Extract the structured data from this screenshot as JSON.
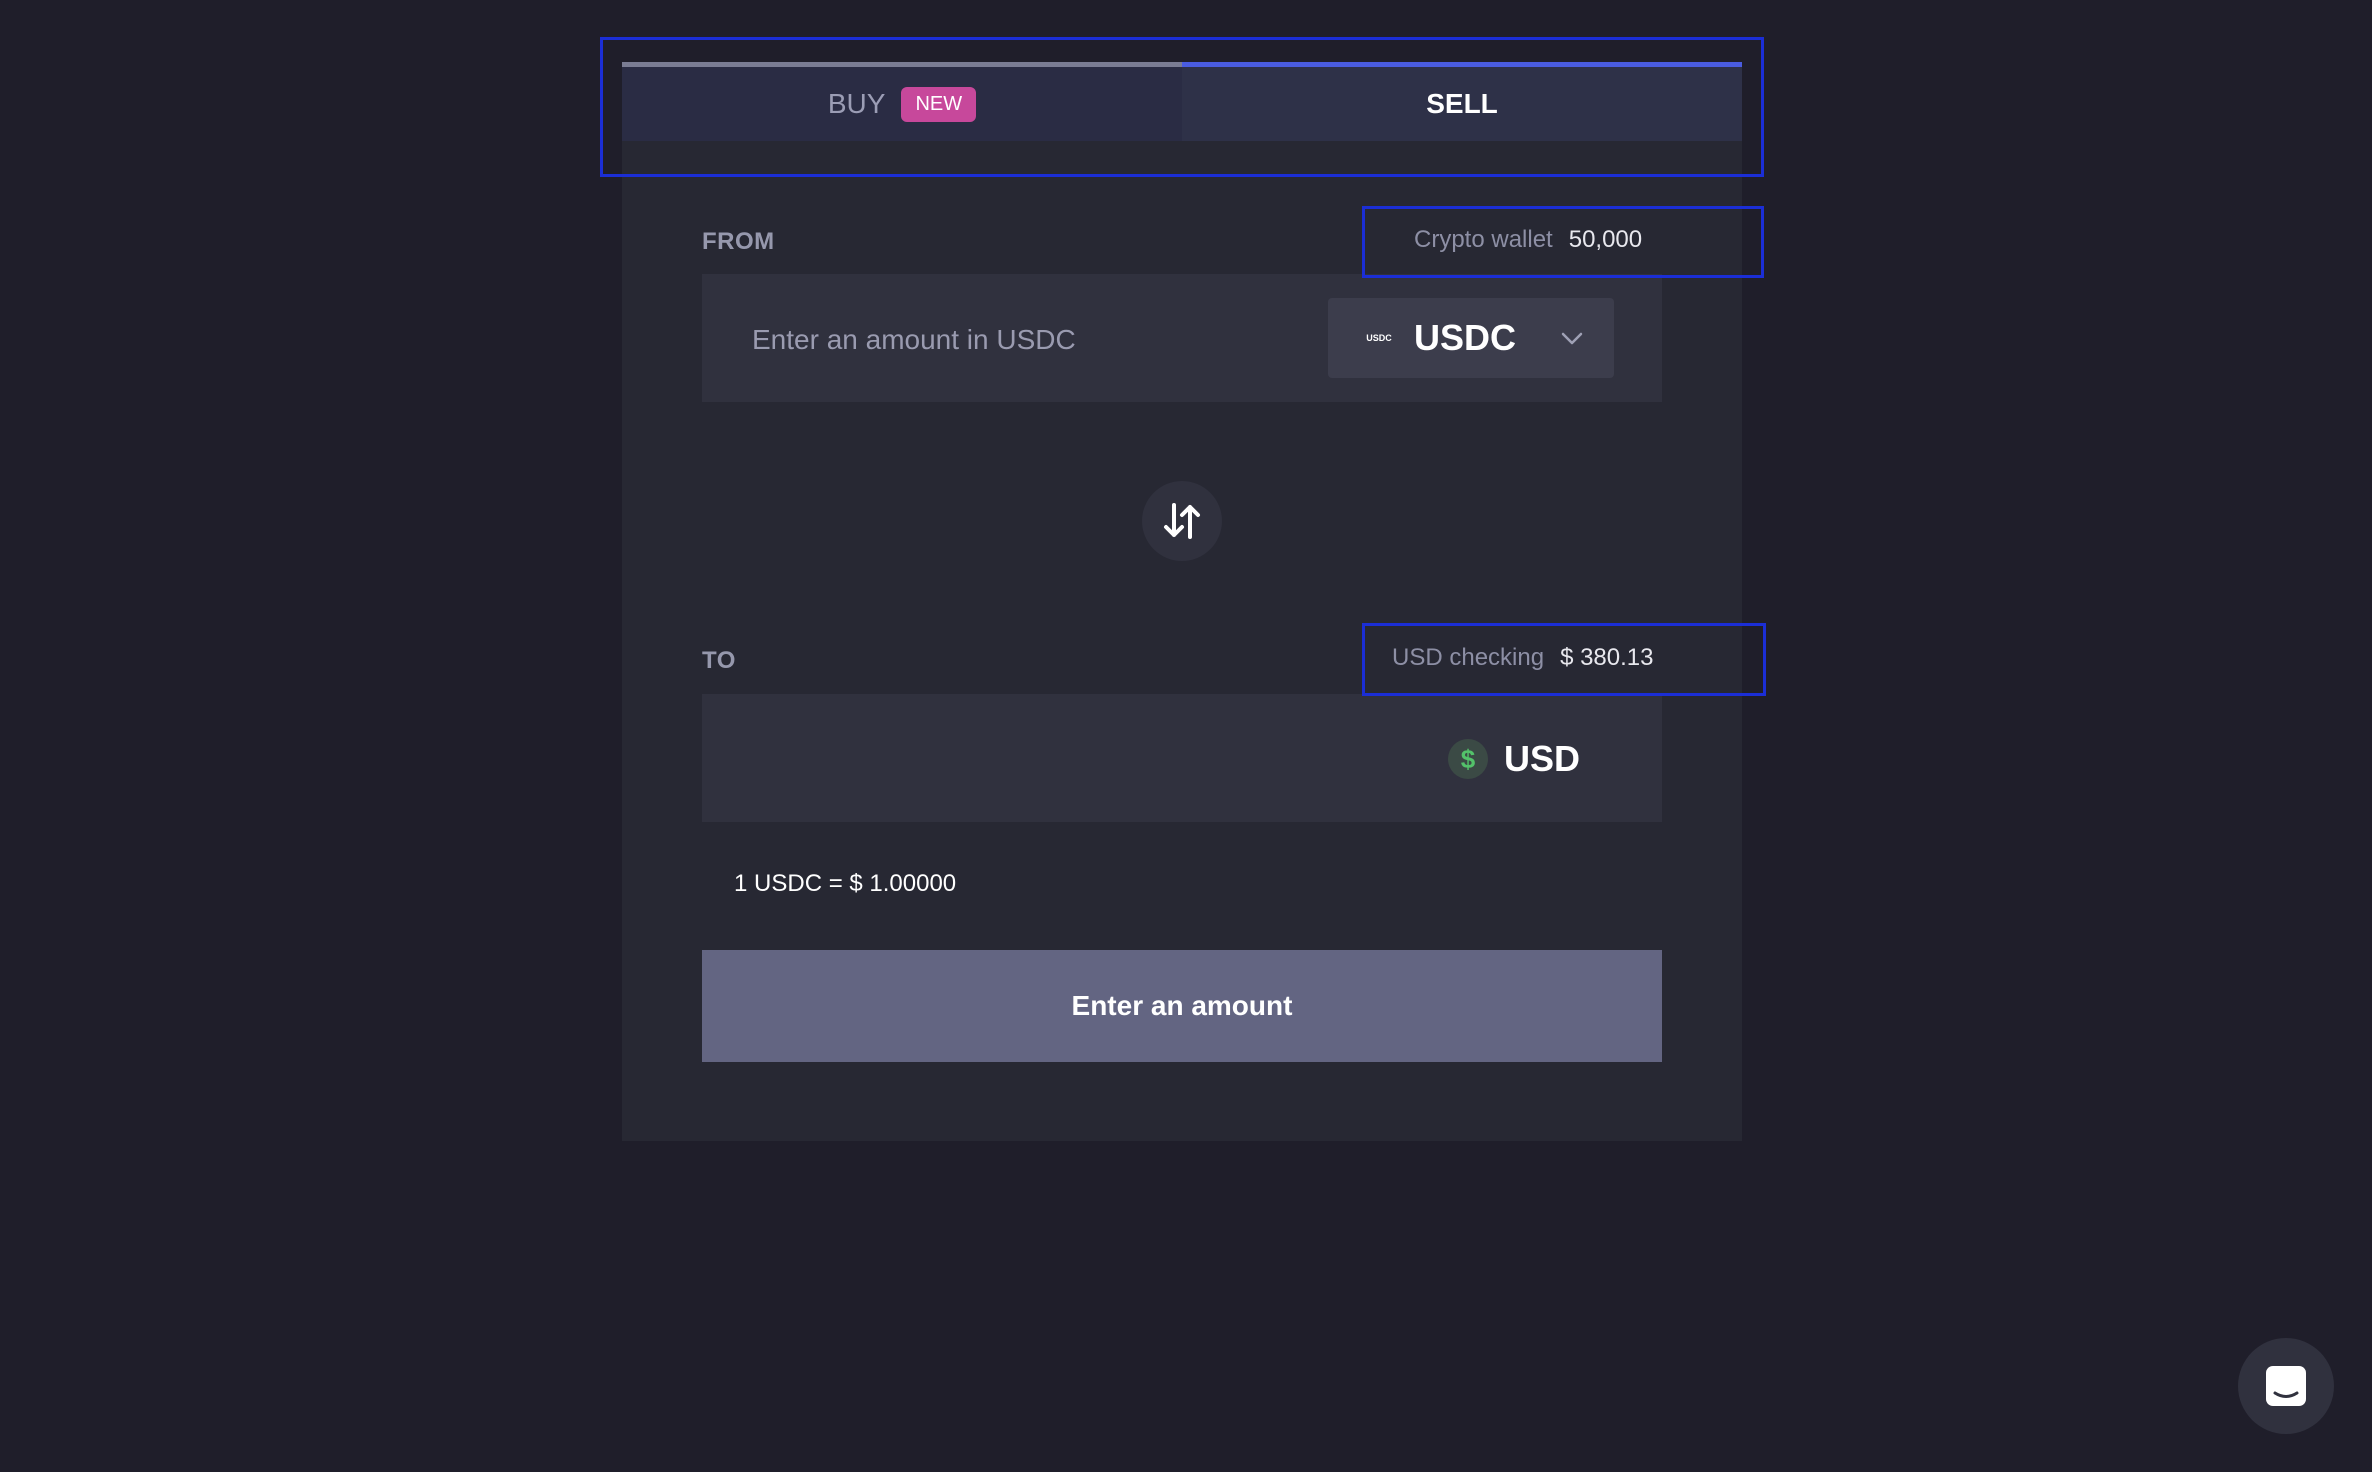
{
  "tabs": {
    "buy_label": "BUY",
    "buy_badge": "NEW",
    "sell_label": "SELL",
    "active": "SELL"
  },
  "from": {
    "label": "FROM",
    "balance_label": "Crypto wallet",
    "balance_value": "50,000",
    "amount_value": "",
    "amount_placeholder": "Enter an amount in USDC",
    "token": "USDC",
    "token_logo_text": "USDC",
    "token_icon": "usdc-logo-icon"
  },
  "swap": {
    "icon": "swap-arrows-icon"
  },
  "to": {
    "label": "TO",
    "balance_label": "USD checking",
    "balance_value": "$ 380.13",
    "currency_symbol": "$",
    "currency": "USD",
    "currency_icon": "dollar-icon"
  },
  "rate": "1 USDC = $ 1.00000",
  "cta_label": "Enter an amount",
  "chat": {
    "icon": "chat-icon"
  },
  "colors": {
    "background": "#1f1e2a",
    "card": "#272833",
    "active_tab_border": "#4a5ce0",
    "badge": "#c7489b",
    "cta": "#636582",
    "highlight_outline": "#1b2ed6",
    "dollar_green": "#53c26a"
  }
}
